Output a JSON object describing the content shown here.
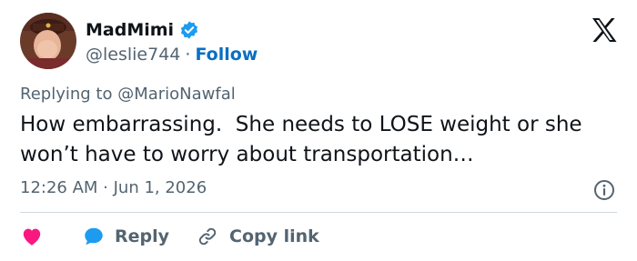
{
  "author": {
    "display_name": "MadMimi",
    "handle": "@leslie744",
    "separator": "·",
    "follow_label": "Follow",
    "verified": true
  },
  "reply_context": "Replying to @MarioNawfal",
  "tweet": {
    "text": "How embarrassing.  She needs to LOSE weight or she won’t have to worry about transportation…",
    "timestamp": "12:26 AM · Jun 1, 2026"
  },
  "actions": {
    "like_icon": "heart-icon",
    "reply_label": "Reply",
    "copy_label": "Copy link"
  },
  "colors": {
    "text": "#0f1419",
    "muted": "#536471",
    "accent": "#0a6fc2",
    "like": "#f91880",
    "reply_bubble": "#1d9bf0",
    "verified": "#1d9bf0"
  }
}
